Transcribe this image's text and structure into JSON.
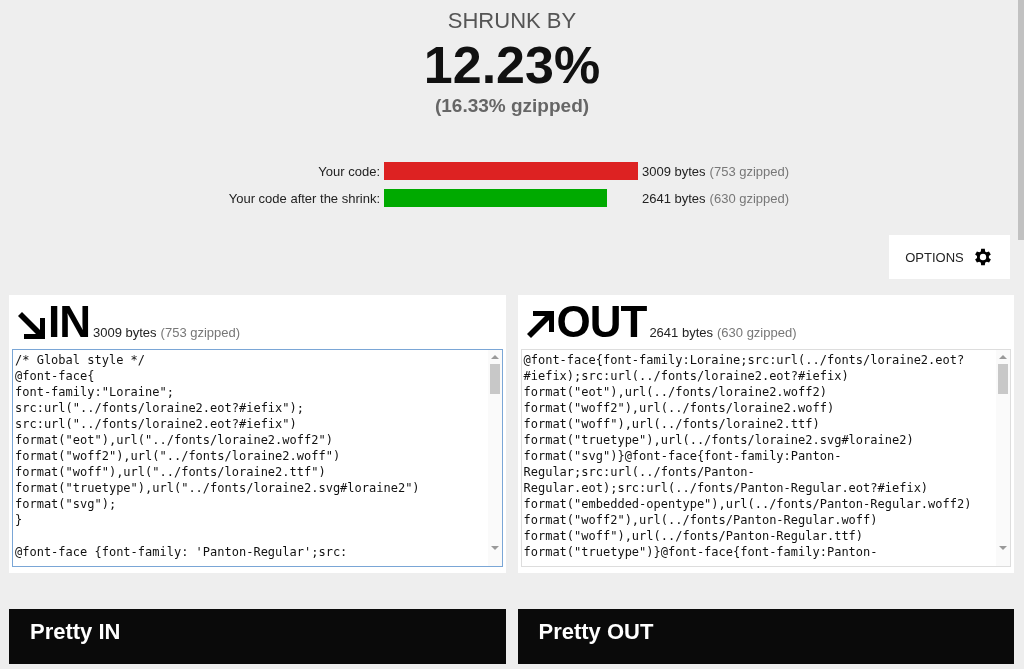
{
  "summary": {
    "heading": "SHRUNK BY",
    "percent": "12.23%",
    "gzipped": "(16.33% gzipped)"
  },
  "bars": [
    {
      "label": "Your code:",
      "color": "#dd2222",
      "bytes": "3009 bytes",
      "gzipped": "(753 gzipped)"
    },
    {
      "label": "Your code after the shrink:",
      "color": "#00aa00",
      "bytes": "2641 bytes",
      "gzipped": "(630 gzipped)"
    }
  ],
  "options_button": "OPTIONS",
  "panels": [
    {
      "kind": "in",
      "title": "IN",
      "bytes": "3009 bytes",
      "gzipped": "(753 gzipped)",
      "focused": true,
      "blocks": [
        [
          "/* Global style */",
          "@font-face{",
          "font-family:\"Loraine\";",
          "src:url(\"../fonts/loraine2.eot?#iefix\");",
          "src:url(\"../fonts/loraine2.eot?#iefix\")",
          "format(\"eot\"),url(\"../fonts/loraine2.woff2\")",
          "format(\"woff2\"),url(\"../fonts/loraine2.woff\")",
          "format(\"woff\"),url(\"../fonts/loraine2.ttf\")",
          "format(\"truetype\"),url(\"../fonts/loraine2.svg#loraine2\")",
          "format(\"svg\");",
          "}"
        ],
        [
          "@font-face {font-family: 'Panton-Regular';src:"
        ]
      ]
    },
    {
      "kind": "out",
      "title": "OUT",
      "bytes": "2641 bytes",
      "gzipped": "(630 gzipped)",
      "focused": false,
      "blocks": [
        [
          "@font-face{font-family:Loraine;src:url(../fonts/loraine2.eot?",
          "#iefix);src:url(../fonts/loraine2.eot?#iefix)",
          "format(\"eot\"),url(../fonts/loraine2.woff2)",
          "format(\"woff2\"),url(../fonts/loraine2.woff)",
          "format(\"woff\"),url(../fonts/loraine2.ttf)",
          "format(\"truetype\"),url(../fonts/loraine2.svg#loraine2)",
          "format(\"svg\")}@font-face{font-family:Panton-",
          "Regular;src:url(../fonts/Panton-",
          "Regular.eot);src:url(../fonts/Panton-Regular.eot?#iefix)",
          "format(\"embedded-opentype\"),url(../fonts/Panton-Regular.woff2)",
          "format(\"woff2\"),url(../fonts/Panton-Regular.woff)",
          "format(\"woff\"),url(../fonts/Panton-Regular.ttf)",
          "format(\"truetype\")}@font-face{font-family:Panton-"
        ]
      ]
    }
  ],
  "pretty_panels": [
    "Pretty IN",
    "Pretty OUT"
  ]
}
